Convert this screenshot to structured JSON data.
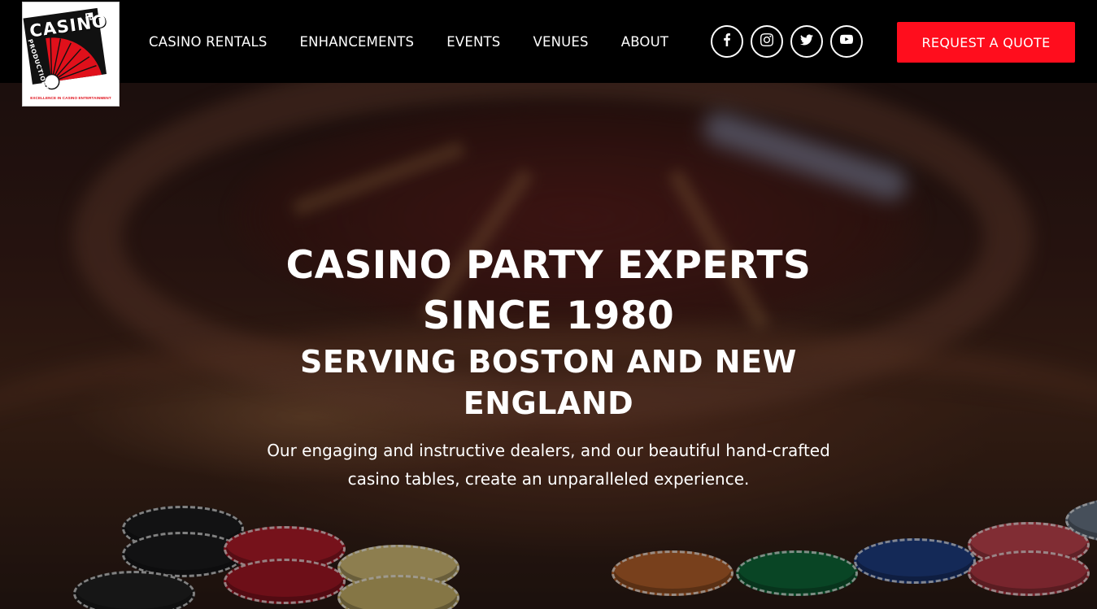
{
  "brand": {
    "logo_word": "CASINO",
    "logo_sub": "PRODUCTIONS",
    "tagline": "EXCELLENCE IN CASINO ENTERTAINMENT",
    "red": "#e0101b"
  },
  "nav": {
    "items": [
      {
        "label": "CASINO RENTALS"
      },
      {
        "label": "ENHANCEMENTS"
      },
      {
        "label": "EVENTS"
      },
      {
        "label": "VENUES"
      },
      {
        "label": "ABOUT"
      }
    ]
  },
  "socials": [
    {
      "icon": "facebook-icon"
    },
    {
      "icon": "instagram-icon"
    },
    {
      "icon": "twitter-icon"
    },
    {
      "icon": "youtube-icon"
    }
  ],
  "cta": {
    "label": "REQUEST A QUOTE",
    "color": "#ff0d1d"
  },
  "hero": {
    "headline_line1": "CASINO PARTY EXPERTS",
    "headline_line2": "SINCE 1980",
    "subheadline_line1": "SERVING BOSTON AND NEW",
    "subheadline_line2": "ENGLAND",
    "description_line1": "Our engaging and instructive dealers, and our beautiful hand-crafted",
    "description_line2": "casino tables, create an unparalleled experience."
  }
}
